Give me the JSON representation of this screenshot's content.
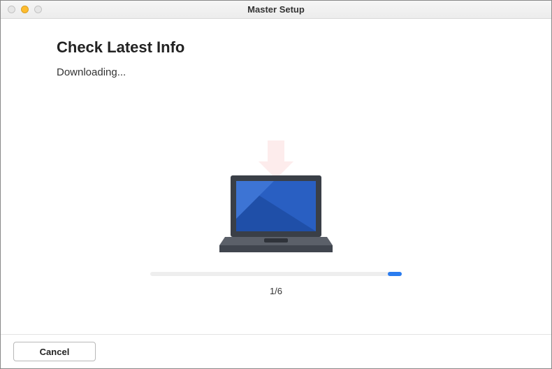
{
  "window": {
    "title": "Master Setup"
  },
  "page": {
    "heading": "Check Latest Info",
    "status": "Downloading..."
  },
  "progress": {
    "label": "1/6"
  },
  "footer": {
    "cancel_label": "Cancel"
  }
}
